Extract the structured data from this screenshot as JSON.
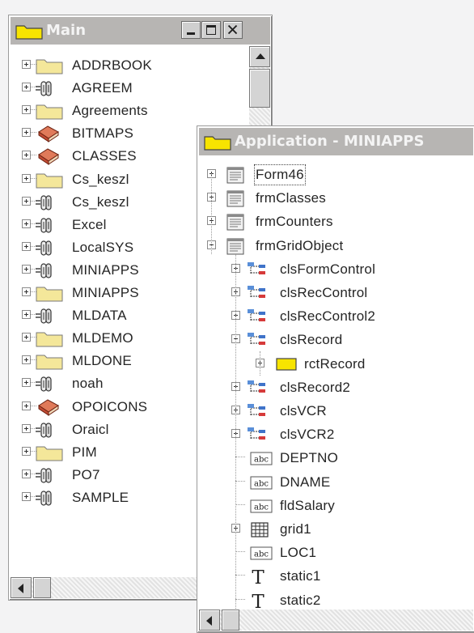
{
  "main_window": {
    "title": "Main",
    "items": [
      {
        "label": "ADDRBOOK",
        "icon": "folder-icon"
      },
      {
        "label": "AGREEM",
        "icon": "database-icon"
      },
      {
        "label": "Agreements",
        "icon": "folder-icon"
      },
      {
        "label": "BITMAPS",
        "icon": "library-book-icon"
      },
      {
        "label": "CLASSES",
        "icon": "library-book-icon"
      },
      {
        "label": "Cs_keszl",
        "icon": "folder-icon"
      },
      {
        "label": "Cs_keszl",
        "icon": "database-icon"
      },
      {
        "label": "Excel",
        "icon": "database-icon"
      },
      {
        "label": "LocalSYS",
        "icon": "database-icon"
      },
      {
        "label": "MINIAPPS",
        "icon": "database-icon"
      },
      {
        "label": "MINIAPPS",
        "icon": "folder-icon"
      },
      {
        "label": "MLDATA",
        "icon": "database-icon"
      },
      {
        "label": "MLDEMO",
        "icon": "folder-icon"
      },
      {
        "label": "MLDONE",
        "icon": "folder-icon"
      },
      {
        "label": "noah",
        "icon": "database-icon"
      },
      {
        "label": "OPOICONS",
        "icon": "library-book-icon"
      },
      {
        "label": "Oraicl",
        "icon": "database-icon"
      },
      {
        "label": "PIM",
        "icon": "folder-icon"
      },
      {
        "label": "PO7",
        "icon": "database-icon"
      },
      {
        "label": "SAMPLE",
        "icon": "database-icon"
      }
    ]
  },
  "app_window": {
    "title": "Application - MINIAPPS",
    "items": [
      {
        "label": "Form46",
        "icon": "form-icon",
        "level": 0,
        "expander": "plus"
      },
      {
        "label": "frmClasses",
        "icon": "form-icon",
        "level": 0,
        "expander": "plus"
      },
      {
        "label": "frmCounters",
        "icon": "form-icon",
        "level": 0,
        "expander": "plus"
      },
      {
        "label": "frmGridObject",
        "icon": "form-icon",
        "level": 0,
        "expander": "minus"
      },
      {
        "label": "clsFormControl",
        "icon": "class-hierarchy-icon",
        "level": 1,
        "expander": "plus"
      },
      {
        "label": "clsRecControl",
        "icon": "class-hierarchy-icon",
        "level": 1,
        "expander": "plus"
      },
      {
        "label": "clsRecControl2",
        "icon": "class-hierarchy-icon",
        "level": 1,
        "expander": "plus"
      },
      {
        "label": "clsRecord",
        "icon": "class-hierarchy-icon",
        "level": 1,
        "expander": "minus"
      },
      {
        "label": "rctRecord",
        "icon": "rectangle-icon",
        "level": 2,
        "expander": "plus"
      },
      {
        "label": "clsRecord2",
        "icon": "class-hierarchy-icon",
        "level": 1,
        "expander": "plus"
      },
      {
        "label": "clsVCR",
        "icon": "class-hierarchy-icon",
        "level": 1,
        "expander": "plus"
      },
      {
        "label": "clsVCR2",
        "icon": "class-hierarchy-icon",
        "level": 1,
        "expander": "plus"
      },
      {
        "label": "DEPTNO",
        "icon": "text-field-icon",
        "level": 1,
        "expander": "none"
      },
      {
        "label": "DNAME",
        "icon": "text-field-icon",
        "level": 1,
        "expander": "none"
      },
      {
        "label": "fldSalary",
        "icon": "text-field-icon",
        "level": 1,
        "expander": "none"
      },
      {
        "label": "grid1",
        "icon": "grid-icon",
        "level": 1,
        "expander": "plus"
      },
      {
        "label": "LOC1",
        "icon": "text-field-icon",
        "level": 1,
        "expander": "none"
      },
      {
        "label": "static1",
        "icon": "static-text-icon",
        "level": 1,
        "expander": "none"
      },
      {
        "label": "static2",
        "icon": "static-text-icon",
        "level": 1,
        "expander": "none"
      }
    ]
  },
  "icons": {
    "text_field_glyph": "abc",
    "static_text_glyph": "T"
  },
  "colors": {
    "titlebar_inactive": "#b7b5b3",
    "folder_yellow": "#f4e79a",
    "rect_yellow": "#f7e400",
    "book_red": "#c24b34"
  }
}
